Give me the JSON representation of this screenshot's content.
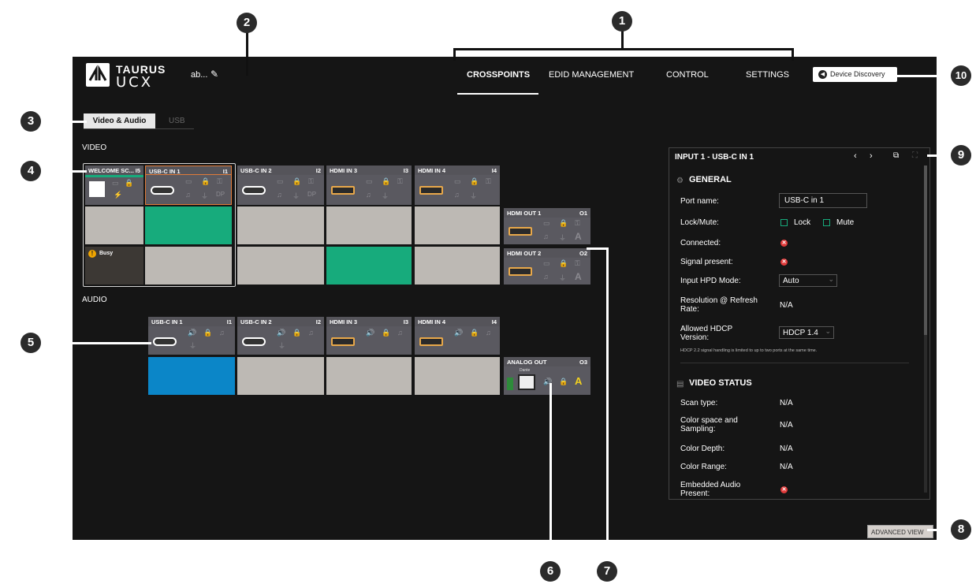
{
  "header": {
    "logo_line1": "TAURUS",
    "logo_line2": "UCX",
    "device_name": "ab...",
    "nav": [
      {
        "label": "CROSSPOINTS",
        "active": true
      },
      {
        "label": "EDID MANAGEMENT",
        "active": false
      },
      {
        "label": "CONTROL",
        "active": false
      },
      {
        "label": "SETTINGS",
        "active": false
      }
    ],
    "device_discovery": "Device Discovery"
  },
  "subtabs": [
    "Video & Audio",
    "USB"
  ],
  "video": {
    "label": "VIDEO",
    "welcome": {
      "title": "WELCOME SC...",
      "num": "I5"
    },
    "inputs": [
      {
        "name": "USB-C IN 1",
        "num": "I1",
        "port": "usb-c"
      },
      {
        "name": "USB-C IN 2",
        "num": "I2",
        "port": "usb-c"
      },
      {
        "name": "HDMI IN 3",
        "num": "I3",
        "port": "hdmi"
      },
      {
        "name": "HDMI IN 4",
        "num": "I4",
        "port": "hdmi"
      }
    ],
    "outputs": [
      {
        "name": "HDMI OUT 1",
        "num": "O1"
      },
      {
        "name": "HDMI OUT 2",
        "num": "O2"
      }
    ],
    "busy_label": "Busy"
  },
  "audio": {
    "label": "AUDIO",
    "inputs": [
      {
        "name": "USB-C IN 1",
        "num": "I1",
        "port": "usb-c"
      },
      {
        "name": "USB-C IN 2",
        "num": "I2",
        "port": "usb-c"
      },
      {
        "name": "HDMI IN 3",
        "num": "I3",
        "port": "hdmi"
      },
      {
        "name": "HDMI IN 4",
        "num": "I4",
        "port": "hdmi"
      }
    ],
    "output": {
      "name": "ANALOG OUT",
      "num": "O3",
      "dante": "Dante"
    }
  },
  "panel": {
    "title": "INPUT 1 - USB-C IN 1",
    "general": "GENERAL",
    "port_name_label": "Port name:",
    "port_name_value": "USB-C in 1",
    "lock_mute_label": "Lock/Mute:",
    "lock": "Lock",
    "mute": "Mute",
    "connected_label": "Connected:",
    "signal_label": "Signal present:",
    "hpd_label": "Input HPD Mode:",
    "hpd_value": "Auto",
    "resolution_label": "Resolution @ Refresh Rate:",
    "resolution_value": "N/A",
    "hdcp_label": "Allowed HDCP Version:",
    "hdcp_value": "HDCP 1.4",
    "hdcp_note": "HDCP 2.2 signal handling is limited to up to two ports at the same time.",
    "video_status": "VIDEO STATUS",
    "scan_label": "Scan type:",
    "scan_value": "N/A",
    "colorspace_label": "Color space and Sampling:",
    "colorspace_value": "N/A",
    "depth_label": "Color Depth:",
    "depth_value": "N/A",
    "range_label": "Color Range:",
    "range_value": "N/A",
    "embedded_label": "Embedded Audio Present:"
  },
  "advanced_view": "ADVANCED VIEW",
  "callouts": [
    "1",
    "2",
    "3",
    "4",
    "5",
    "6",
    "7",
    "8",
    "9",
    "10"
  ],
  "colors": {
    "green": "#17ab7c",
    "blue": "#0b86c8",
    "grey": "#bdb9b4",
    "busy": "#3c3834",
    "error": "#e03a3a"
  }
}
